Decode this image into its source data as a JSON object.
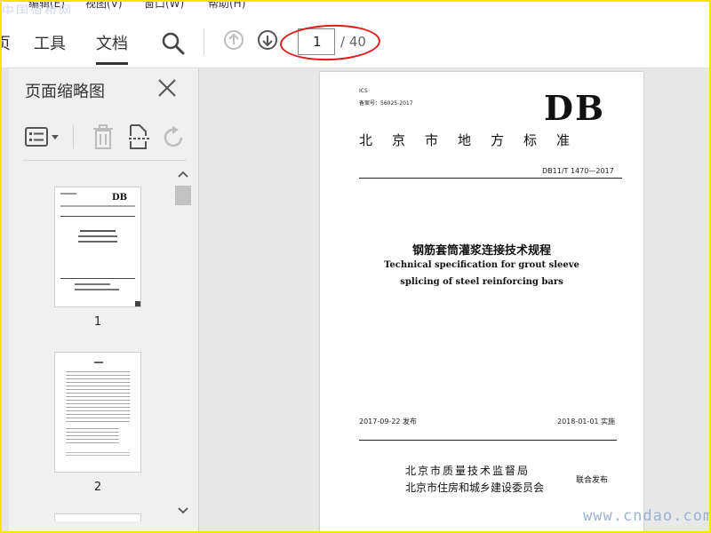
{
  "menubar": {
    "items": [
      "编辑(E)",
      "视图(V)",
      "窗口(W)",
      "帮助(H)"
    ],
    "watermark": "中国道桥网"
  },
  "toolbar": {
    "tabs": [
      "页",
      "工具",
      "文档"
    ],
    "active_tab": "文档",
    "icons": [
      "search-icon",
      "page-up-icon",
      "page-down-icon"
    ],
    "current_page": "1",
    "total_pages": "/ 40",
    "highlight_color": "#e01b1b"
  },
  "left_panel": {
    "title": "页面缩略图",
    "thumbnails": [
      {
        "label": "1",
        "mini_logo": "DB"
      },
      {
        "label": "2"
      }
    ]
  },
  "document": {
    "ics": "ICS",
    "record_no": "备案号：56025-2017",
    "logo": "DB",
    "logo_sub": "北京市地方标准",
    "code": "DB11/T 1470—2017",
    "title_cn": "钢筋套筒灌浆连接技术规程",
    "title_en_1": "Technical specification for grout sleeve",
    "title_en_2": "splicing of steel reinforcing bars",
    "publish_date": "2017-09-22 发布",
    "effective_date": "2018-01-01 实施",
    "issuer_1": "北京市质量技术监督局",
    "issuer_2": "北京市住房和城乡建设委员会",
    "joint_issue": "联合发布"
  },
  "watermark_bottom": "www.cndao.com",
  "colors": {
    "frame": "#f5e600",
    "panel_bg": "#f0f0f0",
    "doc_bg": "#e8e8e8"
  }
}
